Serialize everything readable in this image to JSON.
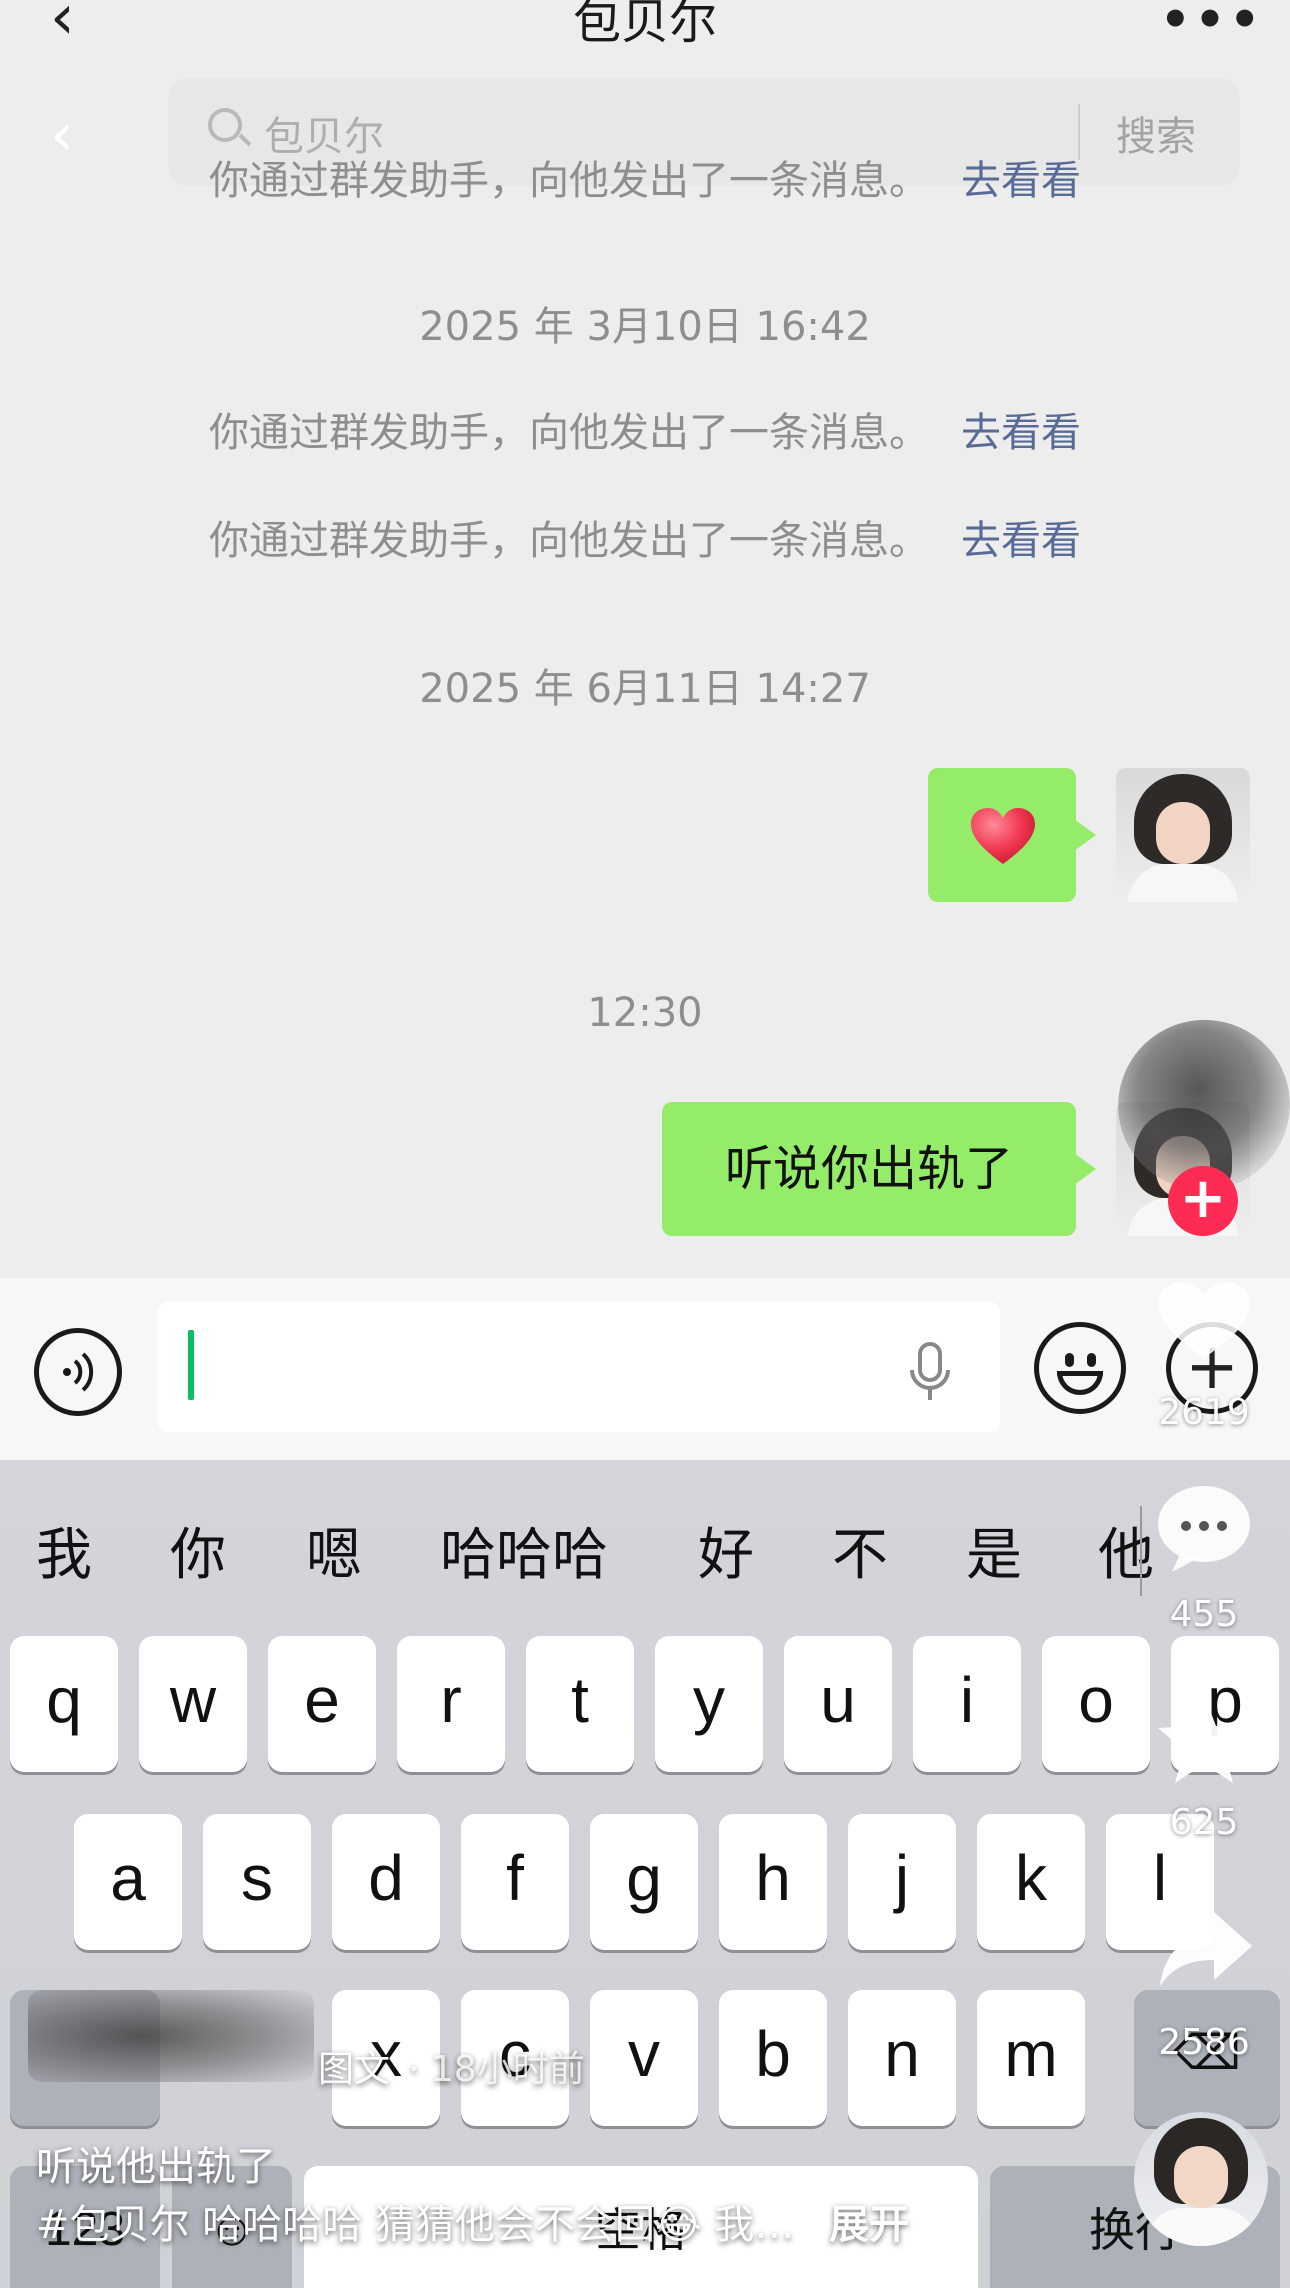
{
  "header": {
    "title": "包贝尔",
    "back_icon": "chevron-left-icon",
    "more_icon": "more-dots-icon"
  },
  "search": {
    "placeholder": "包贝尔",
    "button_label": "搜索"
  },
  "messages": {
    "system_text": "你通过群发助手，向他发出了一条消息。",
    "system_link": "去看看",
    "timestamp_1": "2025 年 3月10日 16:42",
    "timestamp_2": "2025 年 6月11日 14:27",
    "timestamp_3": "12:30",
    "heart_message": "heart-emoji",
    "text_message": "听说你出轨了"
  },
  "input": {
    "voice_icon": "voice-icon",
    "mic_icon": "microphone-icon",
    "emoji_icon": "emoji-icon",
    "plus_icon": "plus-icon"
  },
  "keyboard": {
    "candidates": [
      "我",
      "你",
      "嗯",
      "哈哈哈",
      "好",
      "不",
      "是",
      "他"
    ],
    "row1": [
      "q",
      "w",
      "e",
      "r",
      "t",
      "y",
      "u",
      "i",
      "o",
      "p"
    ],
    "row2": [
      "a",
      "s",
      "d",
      "f",
      "g",
      "h",
      "j",
      "k",
      "l"
    ],
    "row3": [
      "x",
      "c",
      "v",
      "b",
      "n",
      "m"
    ],
    "numbers_key": "123",
    "space_key": "空格",
    "return_key": "换行"
  },
  "overlay": {
    "like_count": "2619",
    "comment_count": "455",
    "favorite_count": "625",
    "share_count": "2586",
    "post_type": "图文",
    "post_time": "· 18小时前",
    "caption_title": "听说他出轨了",
    "caption_body": "#包贝尔 哈哈哈哈 猜猜他会不会回😂 我…",
    "expand_label": "展开"
  },
  "colors": {
    "bubble_green": "#95ec69",
    "link_blue": "#576b95",
    "caret_green": "#07c160",
    "follow_red": "#fe2c55"
  }
}
